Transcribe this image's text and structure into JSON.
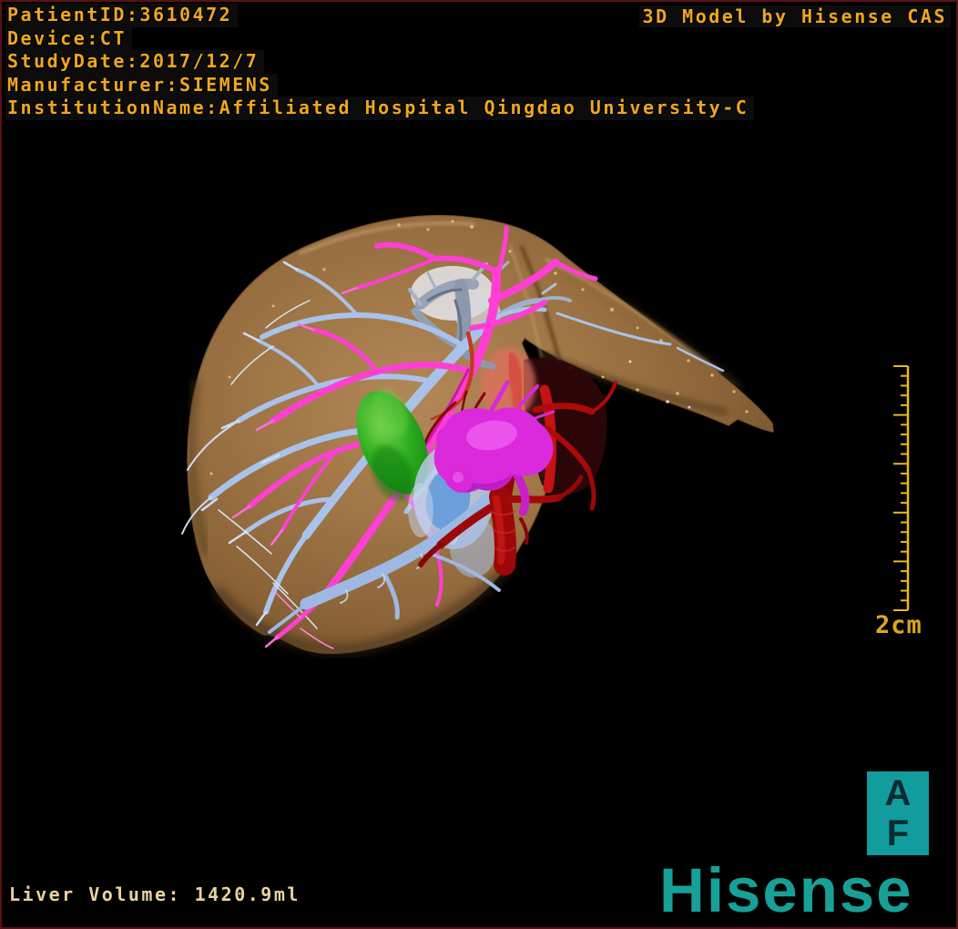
{
  "header": {
    "patient_lines": [
      "PatientID:3610472",
      "Device:CT",
      "StudyDate:2017/12/7",
      "Manufacturer:SIEMENS",
      "InstitutionName:Affiliated Hospital Qingdao University-C"
    ],
    "model_credit": "3D Model by Hisense CAS"
  },
  "footer": {
    "liver_volume": "Liver Volume: 1420.9ml"
  },
  "scale_bar": {
    "label": "2cm"
  },
  "orientation_marker": {
    "letters": [
      "A",
      "F"
    ]
  },
  "branding": {
    "logo": "Hisense"
  },
  "colors": {
    "overlay_text_gold": "#efa71e",
    "volume_text_cream": "#e9d2a0",
    "brand_teal": "#17a098",
    "orientation_box_teal": "#129c9e",
    "ruler_gold": "#e9b71e",
    "border_maroon": "#5a1015",
    "background": "#000000",
    "liver_surface_tan": "#a57a49",
    "hepatic_vein_blue": "#a9c2ea",
    "portal_vein_pink": "#ff3fd4",
    "tumor_green": "#2aa61e",
    "artery_red": "#b30b0b",
    "duct_magenta": "#da2adc",
    "ivc_translucent_blue": "#b9cdee",
    "vein_confluence_gray": "#99a3b6"
  }
}
